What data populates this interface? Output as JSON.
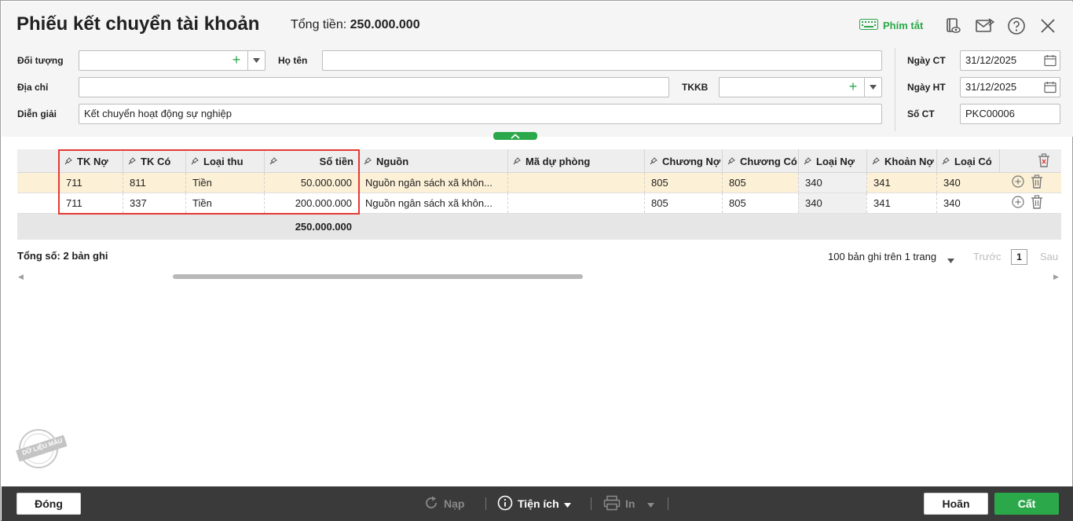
{
  "header": {
    "title": "Phiếu kết chuyển tài khoản",
    "total_label": "Tổng tiền:",
    "total_value": "250.000.000",
    "shortcut_label": "Phím tắt"
  },
  "form": {
    "doi_tuong_label": "Đối tượng",
    "doi_tuong_value": "",
    "ho_ten_label": "Họ tên",
    "ho_ten_value": "",
    "dia_chi_label": "Địa chỉ",
    "dia_chi_value": "",
    "tkkb_label": "TKKB",
    "tkkb_value": "",
    "dien_giai_label": "Diễn giải",
    "dien_giai_value": "Kết chuyển hoạt động sự nghiệp",
    "ngay_ct_label": "Ngày CT",
    "ngay_ct_value": "31/12/2025",
    "ngay_ht_label": "Ngày HT",
    "ngay_ht_value": "31/12/2025",
    "so_ct_label": "Số CT",
    "so_ct_value": "PKC00006"
  },
  "grid": {
    "columns": [
      "TK Nợ",
      "TK Có",
      "Loại thu",
      "Số tiền",
      "Nguồn",
      "Mã dự phòng",
      "Chương Nợ",
      "Chương Có",
      "Loại Nợ",
      "Khoản Nợ",
      "Loại Có"
    ],
    "rows": [
      {
        "tk_no": "711",
        "tk_co": "811",
        "loai_thu": "Tiền",
        "so_tien": "50.000.000",
        "nguon": "Nguồn ngân sách xã khôn...",
        "ma_du_phong": "",
        "chuong_no": "805",
        "chuong_co": "805",
        "loai_no": "340",
        "khoan_no": "341",
        "loai_co": "340"
      },
      {
        "tk_no": "711",
        "tk_co": "337",
        "loai_thu": "Tiền",
        "so_tien": "200.000.000",
        "nguon": "Nguồn ngân sách xã khôn...",
        "ma_du_phong": "",
        "chuong_no": "805",
        "chuong_co": "805",
        "loai_no": "340",
        "khoan_no": "341",
        "loai_co": "340"
      }
    ],
    "footer_total": "250.000.000"
  },
  "summary": {
    "total_records": "Tổng số: 2 bản ghi",
    "pager_text": "100 bản ghi trên 1 trang",
    "prev": "Trước",
    "page": "1",
    "next": "Sau"
  },
  "stamp_text": "DỮ LIỆU MẪU",
  "footer": {
    "close": "Đóng",
    "reload": "Nạp",
    "utilities": "Tiện ích",
    "print": "In",
    "cancel": "Hoãn",
    "save": "Cất"
  },
  "colors": {
    "accent": "#2ba84a",
    "selected_row": "#fcf1d6",
    "highlight_border": "#e53935",
    "footer_bg": "#3a3a3a"
  }
}
